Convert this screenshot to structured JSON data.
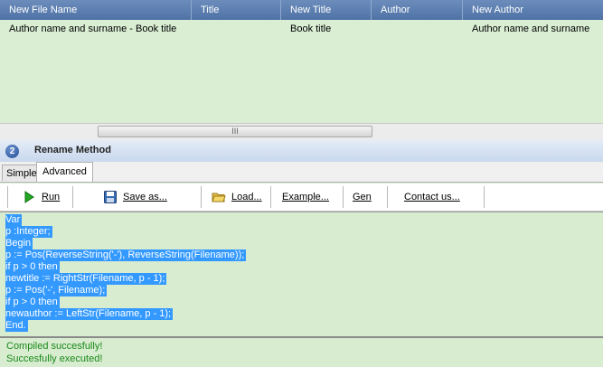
{
  "grid": {
    "columns": [
      "New File Name",
      "Title",
      "New Title",
      "Author",
      "New Author"
    ],
    "rows": [
      {
        "new_file_name": "Author name and surname - Book title",
        "title": "",
        "new_title": "Book title",
        "author": "",
        "new_author": "Author name and surname"
      }
    ]
  },
  "scrollbar": {
    "thumb_grip": "III"
  },
  "section": {
    "number": "2",
    "title": "Rename Method"
  },
  "tabs": [
    {
      "label": "Simple"
    },
    {
      "label": "Advanced"
    }
  ],
  "toolbar": {
    "run": "Run",
    "save_as": "Save as...",
    "load": "Load...",
    "example": "Example...",
    "gen": "Gen",
    "contact": "Contact us..."
  },
  "code_lines": [
    "Var",
    "p :Integer;",
    "Begin",
    "p := Pos(ReverseString('-'), ReverseString(Filename));",
    "if p > 0 then",
    "newtitle := RightStr(Filename, p - 1);",
    "p := Pos('-', Filename);",
    "if p > 0 then",
    "newauthor := LeftStr(Filename, p - 1);",
    "End."
  ],
  "status": {
    "line1": "Compiled succesfully!",
    "line2": "Succesfully executed!"
  },
  "colors": {
    "status_green": "#1a8a1a",
    "selection_blue": "#3399ff",
    "panel_green": "#d8ecd0"
  }
}
